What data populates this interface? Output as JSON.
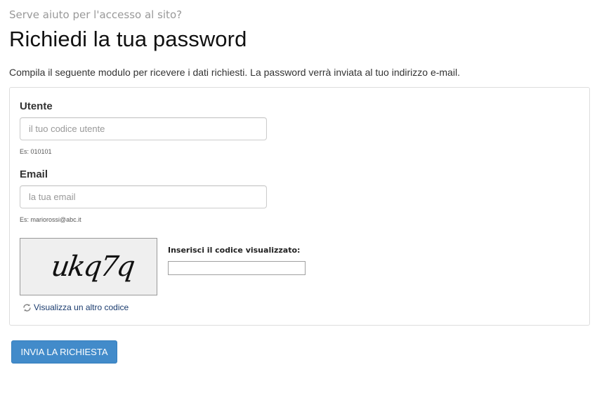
{
  "header": {
    "help_title": "Serve aiuto per l'accesso al sito?",
    "page_title": "Richiedi la tua password",
    "intro": "Compila il seguente modulo per ricevere i dati richiesti. La password verrà inviata al tuo indirizzo e-mail."
  },
  "form": {
    "user": {
      "label": "Utente",
      "placeholder": "il tuo codice utente",
      "value": "",
      "hint": "Es: 010101"
    },
    "email": {
      "label": "Email",
      "placeholder": "la tua email",
      "value": "",
      "hint": "Es: mariorossi@abc.it"
    },
    "captcha": {
      "image_text": "ukq7q",
      "label": "Inserisci il codice visualizzato:",
      "value": "",
      "refresh_label": "Visualizza un altro codice",
      "refresh_icon": "refresh-icon"
    },
    "submit_label": "INVIA LA RICHIESTA"
  },
  "colors": {
    "button_bg": "#428bca",
    "link": "#1a3b6e",
    "help_title": "#999999"
  }
}
